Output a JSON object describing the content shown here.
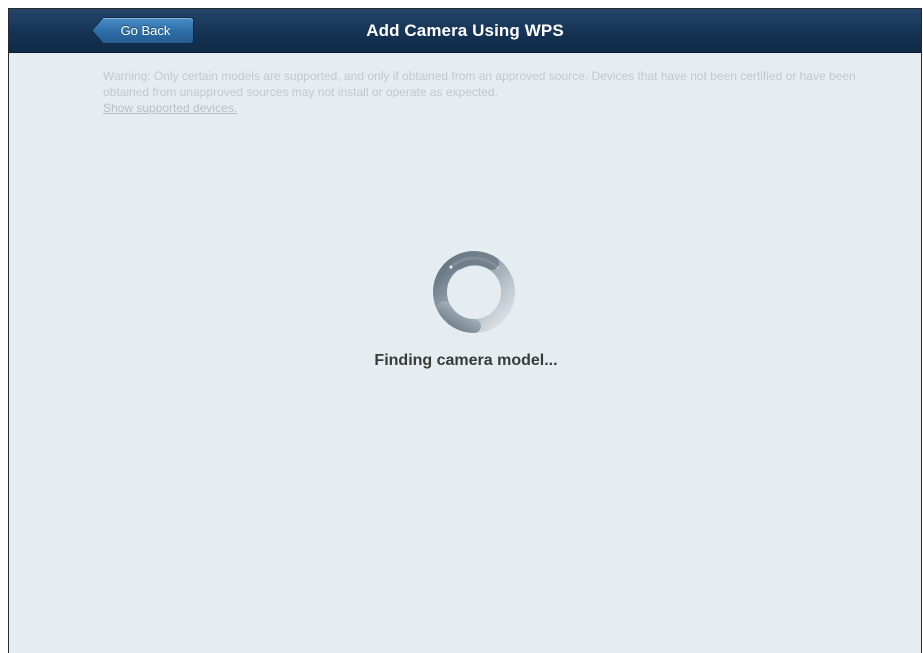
{
  "header": {
    "title": "Add Camera Using WPS",
    "back_label": "Go Back"
  },
  "warning": {
    "text": "Warning: Only certain models are supported, and only if obtained from an approved source. Devices that have not been certified or have been obtained from unapproved sources may not install or operate as expected.",
    "link_label": "Show supported devices."
  },
  "status": {
    "message": "Finding camera model...",
    "spinner_icon": "loading-spinner-icon"
  },
  "colors": {
    "header_bg": "#163354",
    "content_bg": "#e6edf0",
    "back_button": "#2f6fa8",
    "status_text": "#3a3a3a",
    "warning_text": "#c2c9cd"
  }
}
